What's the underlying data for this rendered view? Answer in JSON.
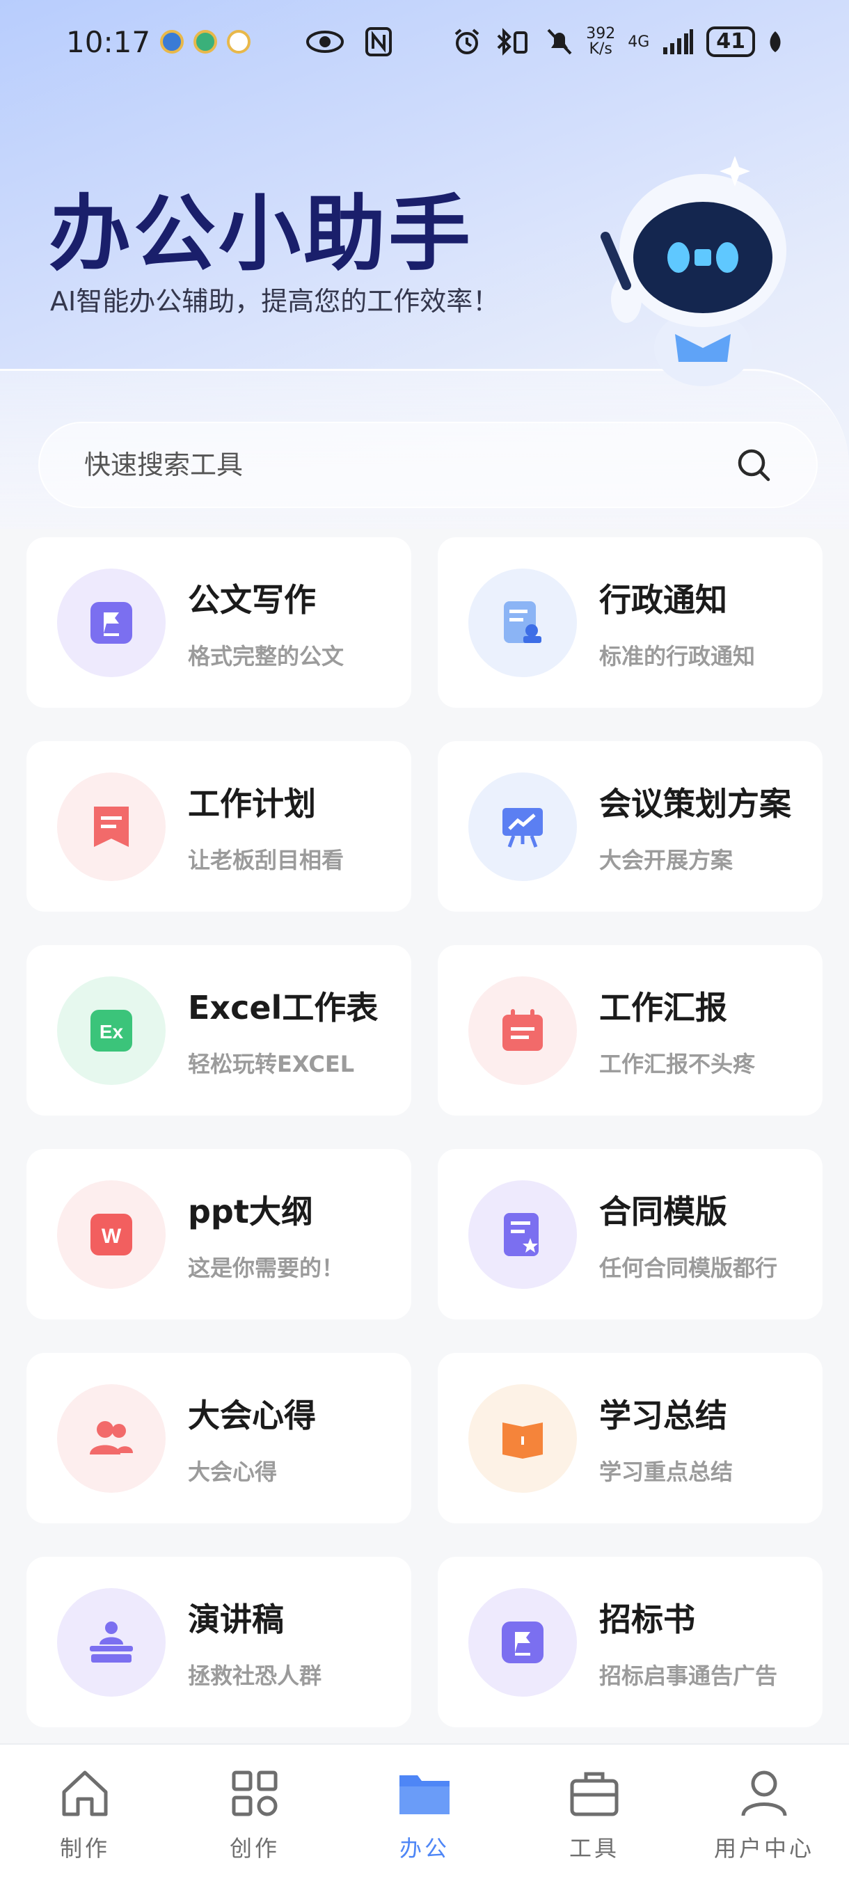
{
  "status_bar": {
    "time": "10:17",
    "net_speed_value": "392",
    "net_speed_unit": "K/s",
    "network": "4G",
    "battery": "41"
  },
  "header": {
    "title": "办公小助手",
    "subtitle": "AI智能办公辅助，提高您的工作效率！"
  },
  "search": {
    "placeholder": "快速搜索工具",
    "value": ""
  },
  "tools": [
    {
      "title": "公文写作",
      "desc": "格式完整的公文",
      "icon": "flag-document-icon",
      "color": "#7b6ff0",
      "bg": "#eeeafd"
    },
    {
      "title": "行政通知",
      "desc": "标准的行政通知",
      "icon": "notice-document-icon",
      "color": "#6d9bf2",
      "bg": "#ebf1fd"
    },
    {
      "title": "工作计划",
      "desc": "让老板刮目相看",
      "icon": "bookmark-plan-icon",
      "color": "#f26a6a",
      "bg": "#fdeeee"
    },
    {
      "title": "会议策划方案",
      "desc": "大会开展方案",
      "icon": "presentation-board-icon",
      "color": "#5b7ff2",
      "bg": "#ebf1fd"
    },
    {
      "title": "Excel工作表",
      "desc": "轻松玩转EXCEL",
      "icon": "excel-icon",
      "color": "#3bc47a",
      "bg": "#e6f8ee"
    },
    {
      "title": "工作汇报",
      "desc": "工作汇报不头疼",
      "icon": "calendar-report-icon",
      "color": "#f26a6a",
      "bg": "#fdeeee"
    },
    {
      "title": "ppt大纲",
      "desc": "这是你需要的！",
      "icon": "word-w-icon",
      "color": "#f25f5f",
      "bg": "#fdeeee"
    },
    {
      "title": "合同模版",
      "desc": "任何合同模版都行",
      "icon": "contract-star-icon",
      "color": "#7b6ff0",
      "bg": "#eeeafd"
    },
    {
      "title": "大会心得",
      "desc": "大会心得",
      "icon": "people-group-icon",
      "color": "#f26a6a",
      "bg": "#fdeeee"
    },
    {
      "title": "学习总结",
      "desc": "学习重点总结",
      "icon": "open-book-icon",
      "color": "#f5843a",
      "bg": "#fdf2e6"
    },
    {
      "title": "演讲稿",
      "desc": "拯救社恐人群",
      "icon": "speaker-podium-icon",
      "color": "#7b6ff0",
      "bg": "#eeeafd"
    },
    {
      "title": "招标书",
      "desc": "招标启事通告广告",
      "icon": "flag-document-icon",
      "color": "#7b6ff0",
      "bg": "#eeeafd"
    }
  ],
  "nav": [
    {
      "label": "制作",
      "icon": "home-icon",
      "active": false
    },
    {
      "label": "创作",
      "icon": "grid-icon",
      "active": false
    },
    {
      "label": "办公",
      "icon": "folder-icon",
      "active": true
    },
    {
      "label": "工具",
      "icon": "briefcase-icon",
      "active": false
    },
    {
      "label": "用户中心",
      "icon": "user-icon",
      "active": false
    }
  ],
  "colors": {
    "accent": "#4e86f6",
    "title": "#1a1f6b"
  }
}
